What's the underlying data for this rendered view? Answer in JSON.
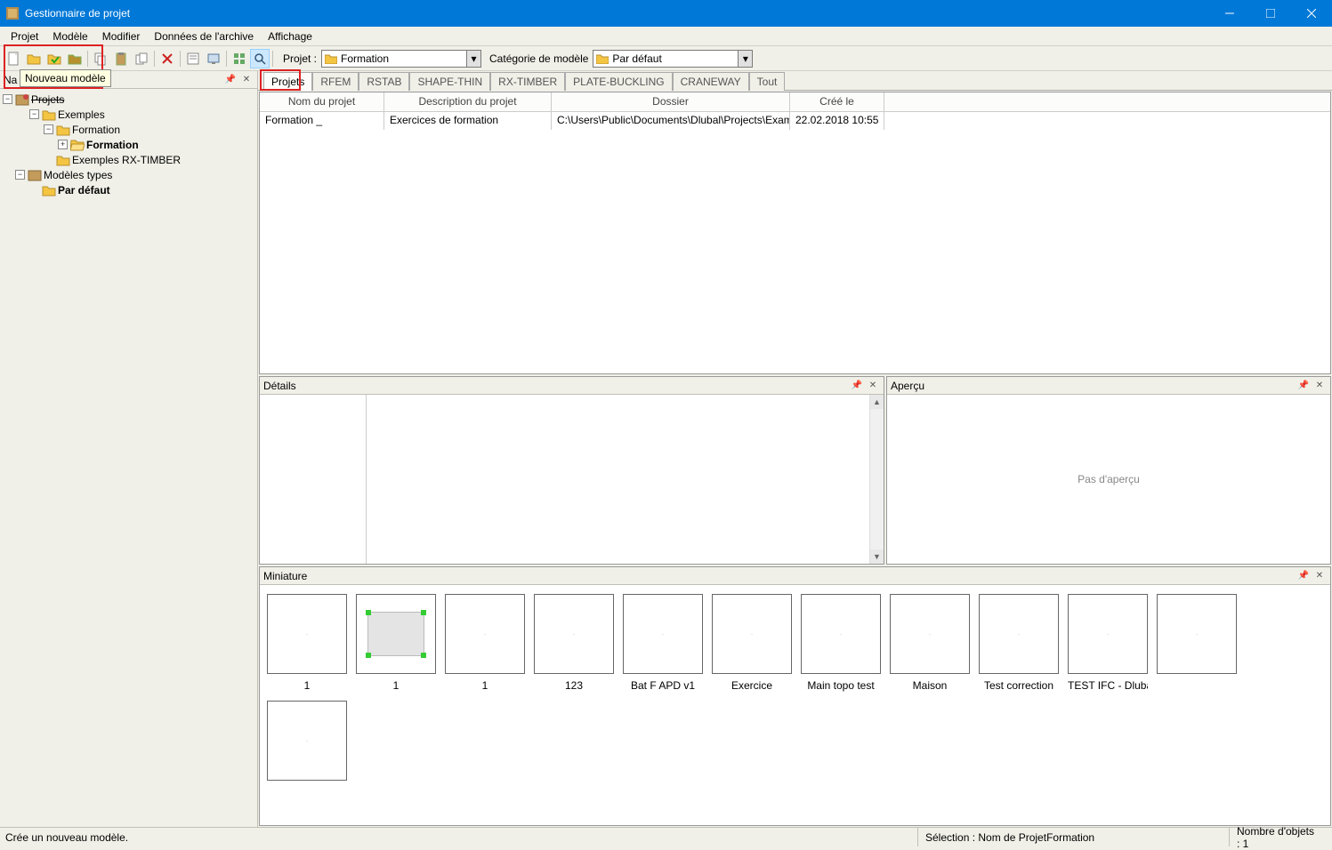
{
  "window": {
    "title": "Gestionnaire de projet"
  },
  "menu": [
    "Projet",
    "Modèle",
    "Modifier",
    "Données de l'archive",
    "Affichage"
  ],
  "toolbar": {
    "tooltip": "Nouveau modèle",
    "project_label": "Projet :",
    "project_value": "Formation",
    "category_label": "Catégorie de modèle",
    "category_value": "Par défaut"
  },
  "nav_panel": {
    "title_prefix": "Na",
    "title": "Navigateur"
  },
  "tree": {
    "root": "Projets",
    "items": [
      {
        "label": "Exemples",
        "indent": 1,
        "exp": "-",
        "folder": true
      },
      {
        "label": "Formation",
        "indent": 2,
        "exp": "-",
        "folder": true
      },
      {
        "label": "Formation",
        "indent": 3,
        "exp": "+",
        "folder_badge": true,
        "bold": true
      },
      {
        "label": "Exemples RX-TIMBER",
        "indent": 2,
        "exp": "",
        "folder": true
      },
      {
        "label": "Modèles types",
        "indent": 0,
        "exp": "-",
        "root_icon": true
      },
      {
        "label": "Par défaut",
        "indent": 1,
        "exp": "",
        "folder": true,
        "bold": true
      }
    ]
  },
  "tabs": [
    "Projets",
    "RFEM",
    "RSTAB",
    "SHAPE-THIN",
    "RX-TIMBER",
    "PLATE-BUCKLING",
    "CRANEWAY",
    "Tout"
  ],
  "active_tab": 0,
  "grid": {
    "headers": [
      "Nom du projet",
      "Description du projet",
      "Dossier",
      "Créé le"
    ],
    "rows": [
      [
        "Formation _",
        "Exercices de formation",
        "C:\\Users\\Public\\Documents\\Dlubal\\Projects\\Examples\\",
        "22.02.2018 10:55"
      ]
    ]
  },
  "details": {
    "title": "Détails"
  },
  "preview": {
    "title": "Aperçu",
    "empty_text": "Pas d'aperçu"
  },
  "miniature": {
    "title": "Miniature",
    "thumbs": [
      "1",
      "1",
      "1",
      "123",
      "Bat F APD v1",
      "Exercice",
      "Main topo test",
      "Maison",
      "Test correction",
      "TEST IFC - Dlubal",
      "",
      ""
    ]
  },
  "status": {
    "left": "Crée un nouveau modèle.",
    "selection": "Sélection : Nom de ProjetFormation",
    "count": "Nombre d'objets : 1"
  }
}
